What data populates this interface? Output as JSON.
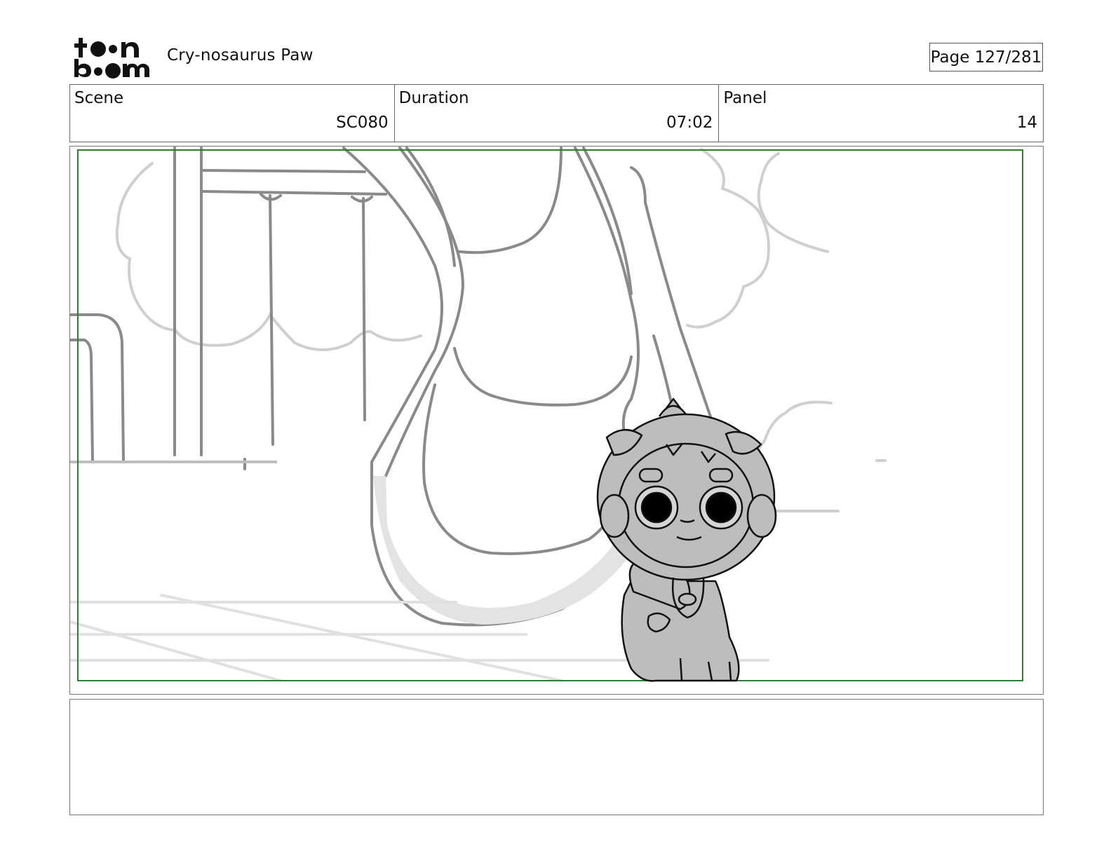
{
  "header": {
    "logo_text": "toon boom",
    "project_title": "Cry-nosaurus Paw",
    "page_label": "Page 127/281"
  },
  "info": {
    "scene_label": "Scene",
    "scene_value": "SC080",
    "duration_label": "Duration",
    "duration_value": "07:02",
    "panel_label": "Panel",
    "panel_value": "14"
  },
  "panel": {
    "safe_frame_color": "#2e7d32",
    "sketch_color": "#8a8a8a",
    "character_fill": "#bdbdbd"
  },
  "notes": {
    "text": ""
  }
}
